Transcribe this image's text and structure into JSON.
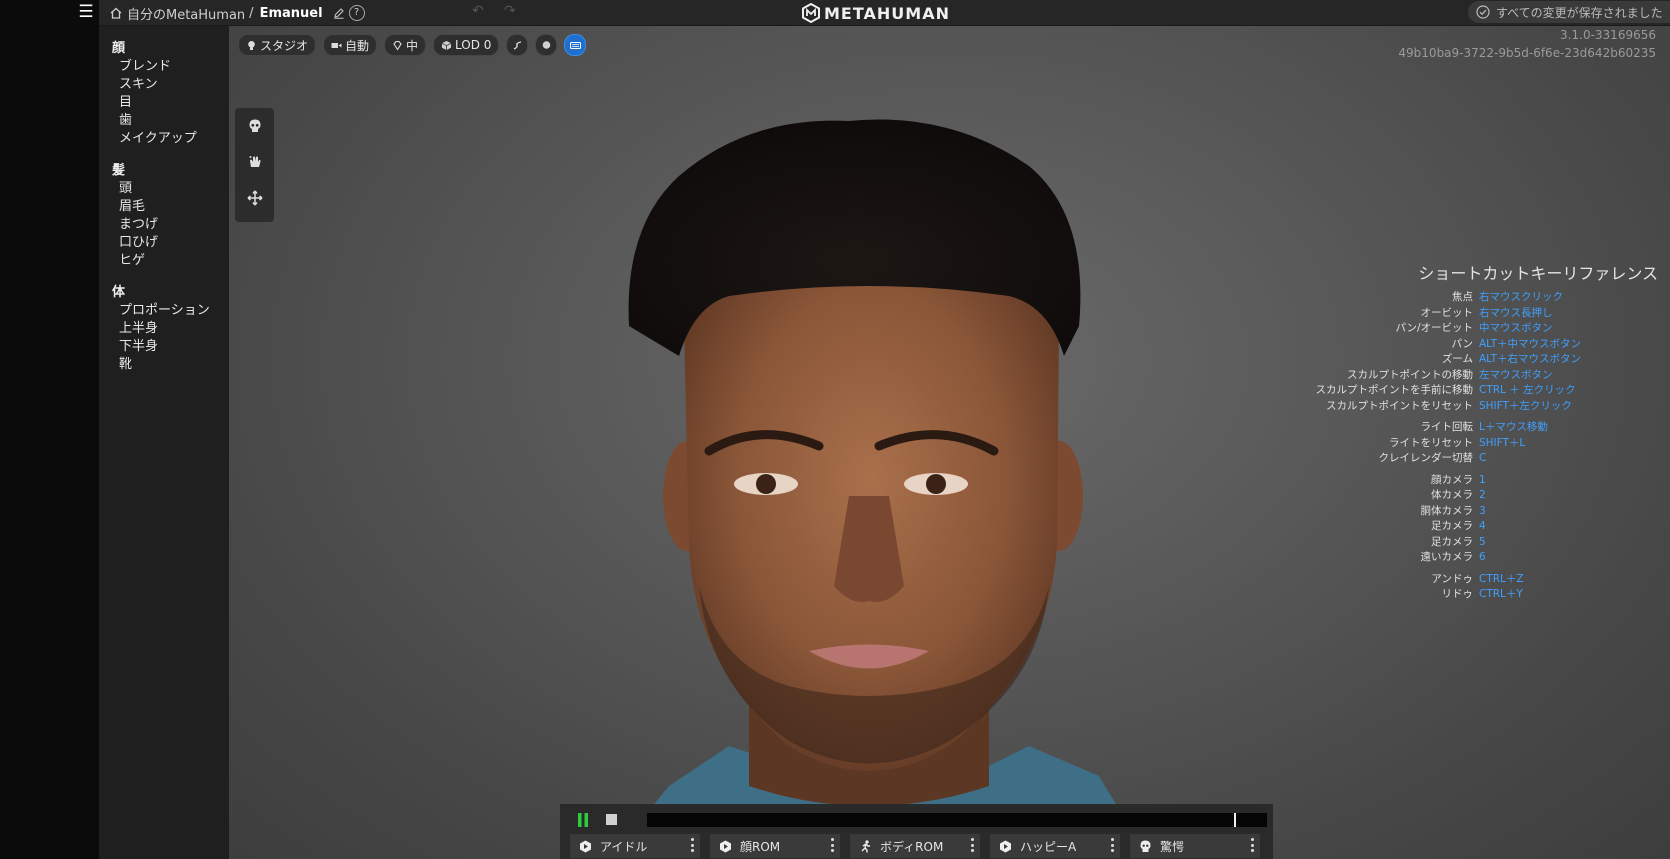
{
  "topbar": {
    "breadcrumb_root": "自分のMetaHuman",
    "breadcrumb_sep": "/",
    "character_name": "Emanuel",
    "help_glyph": "?",
    "logo_text": "METAHUMAN",
    "save_status": "すべての変更が保存されました"
  },
  "sidebar": {
    "groups": [
      {
        "title": "顔",
        "items": [
          "ブレンド",
          "スキン",
          "目",
          "歯",
          "メイクアップ"
        ]
      },
      {
        "title": "髪",
        "items": [
          "頭",
          "眉毛",
          "まつげ",
          "口ひげ",
          "ヒゲ"
        ]
      },
      {
        "title": "体",
        "items": [
          "プロポーション",
          "上半身",
          "下半身",
          "靴"
        ]
      }
    ]
  },
  "viewport_toolbar": {
    "lighting": "スタジオ",
    "camera": "自動",
    "quality": "中",
    "lod": "LOD 0"
  },
  "version": {
    "build": "3.1.0-33169656",
    "hash": "49b10ba9-3722-9b5d-6f6e-23d642b60235"
  },
  "shortcuts": {
    "title": "ショートカットキーリファレンス",
    "groups": [
      [
        {
          "label": "焦点",
          "key": "右マウスクリック"
        },
        {
          "label": "オービット",
          "key": "右マウス長押し"
        },
        {
          "label": "パン/オービット",
          "key": "中マウスボタン"
        },
        {
          "label": "パン",
          "key": "ALT＋中マウスボタン"
        },
        {
          "label": "ズーム",
          "key": "ALT＋右マウスボタン"
        },
        {
          "label": "スカルプトポイントの移動",
          "key": "左マウスボタン"
        },
        {
          "label": "スカルプトポイントを手前に移動",
          "key": "CTRL ＋ 左クリック"
        },
        {
          "label": "スカルプトポイントをリセット",
          "key": "SHIFT＋左クリック"
        }
      ],
      [
        {
          "label": "ライト回転",
          "key": "L＋マウス移動"
        },
        {
          "label": "ライトをリセット",
          "key": "SHIFT＋L"
        },
        {
          "label": "クレイレンダー切替",
          "key": "C"
        }
      ],
      [
        {
          "label": "顔カメラ",
          "key": "1"
        },
        {
          "label": "体カメラ",
          "key": "2"
        },
        {
          "label": "胴体カメラ",
          "key": "3"
        },
        {
          "label": "足カメラ",
          "key": "4"
        },
        {
          "label": "足カメラ",
          "key": "5"
        },
        {
          "label": "遠いカメラ",
          "key": "6"
        }
      ],
      [
        {
          "label": "アンドゥ",
          "key": "CTRL＋Z"
        },
        {
          "label": "リドゥ",
          "key": "CTRL＋Y"
        }
      ]
    ]
  },
  "player": {
    "progress": 0.95,
    "animations": [
      {
        "label": "アイドル",
        "icon": "play-circle-icon"
      },
      {
        "label": "顔ROM",
        "icon": "play-circle-icon"
      },
      {
        "label": "ボディROM",
        "icon": "running-figure-icon"
      },
      {
        "label": "ハッピーA",
        "icon": "play-circle-icon"
      },
      {
        "label": "驚愕",
        "icon": "skull-face-icon"
      }
    ]
  },
  "colors": {
    "accent": "#3fa0ff",
    "play_green": "#2ecc40",
    "active_chip": "#1e6fd0"
  }
}
